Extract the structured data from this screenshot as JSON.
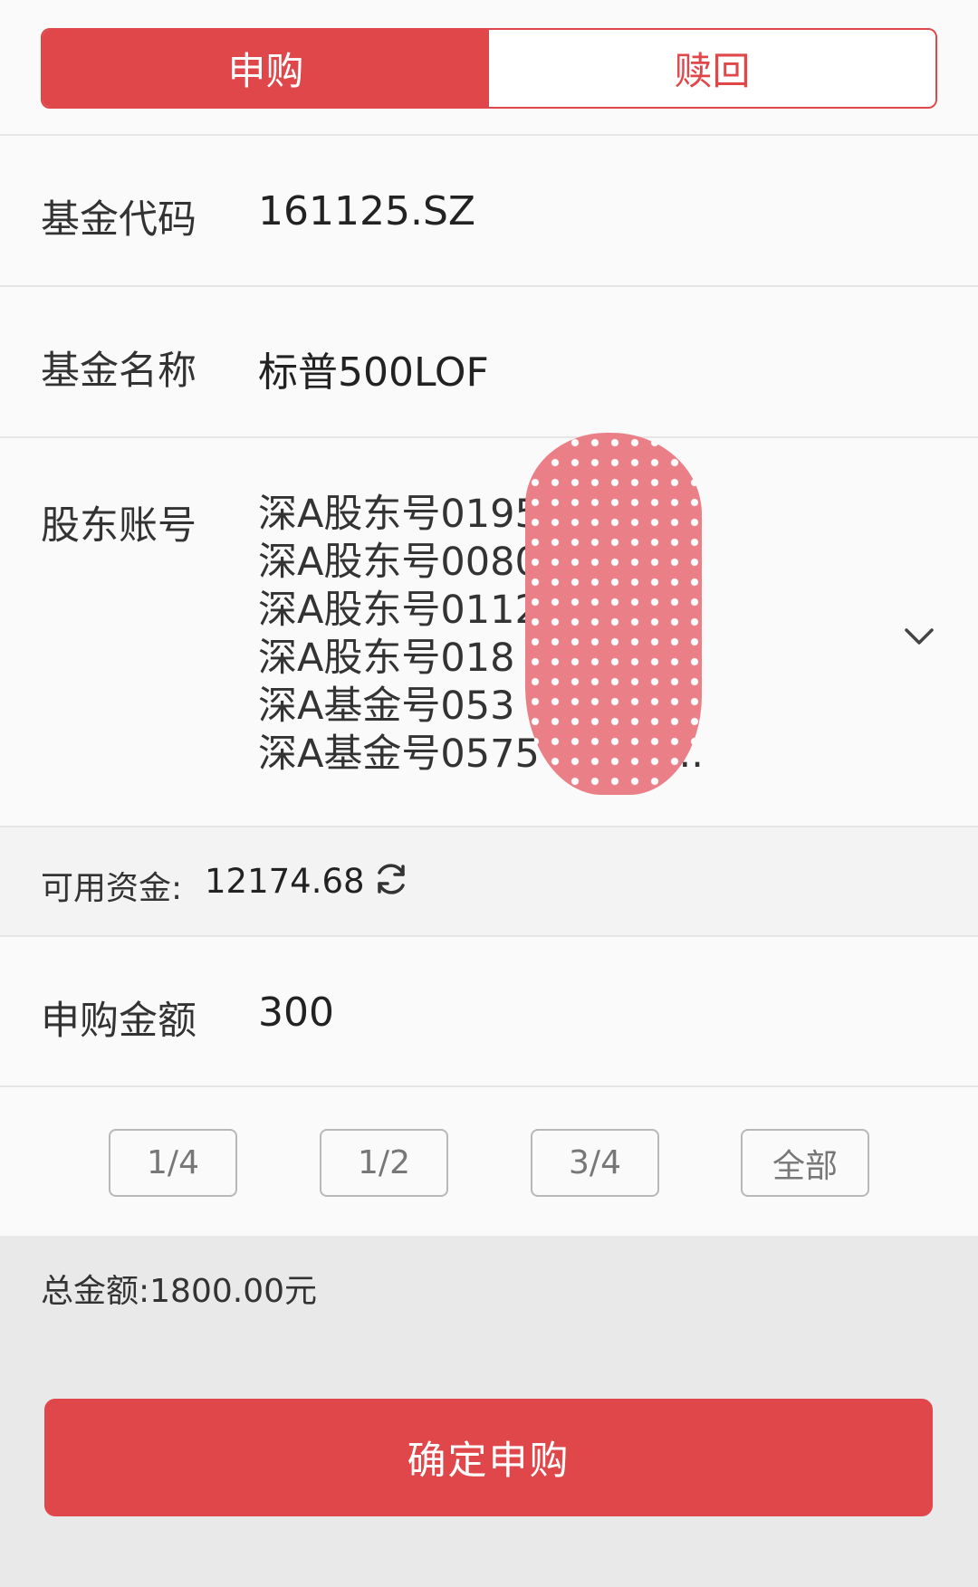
{
  "tabs": [
    {
      "label": "申购",
      "active": true
    },
    {
      "label": "赎回",
      "active": false
    }
  ],
  "fund_code": {
    "label": "基金代码",
    "value": "161125.SZ"
  },
  "fund_name": {
    "label": "基金名称",
    "value": "标普500LOF"
  },
  "shareholder_account": {
    "label": "股东账号",
    "accounts": [
      "深A股东号0195",
      "深A股东号0080",
      "深A股东号0112",
      "深A股东号018",
      "深A基金号053",
      "深A基金号0575"
    ],
    "overflow_suffix": "..."
  },
  "available_funds": {
    "label": "可用资金:",
    "value": "12174.68"
  },
  "purchase_amount": {
    "label": "申购金额",
    "value": "300"
  },
  "fractions": [
    "1/4",
    "1/2",
    "3/4",
    "全部"
  ],
  "total": {
    "label": "总金额:",
    "value": "1800.00元"
  },
  "confirm_label": "确定申购",
  "colors": {
    "accent": "#e0474a",
    "mask": "#ea7f88"
  }
}
